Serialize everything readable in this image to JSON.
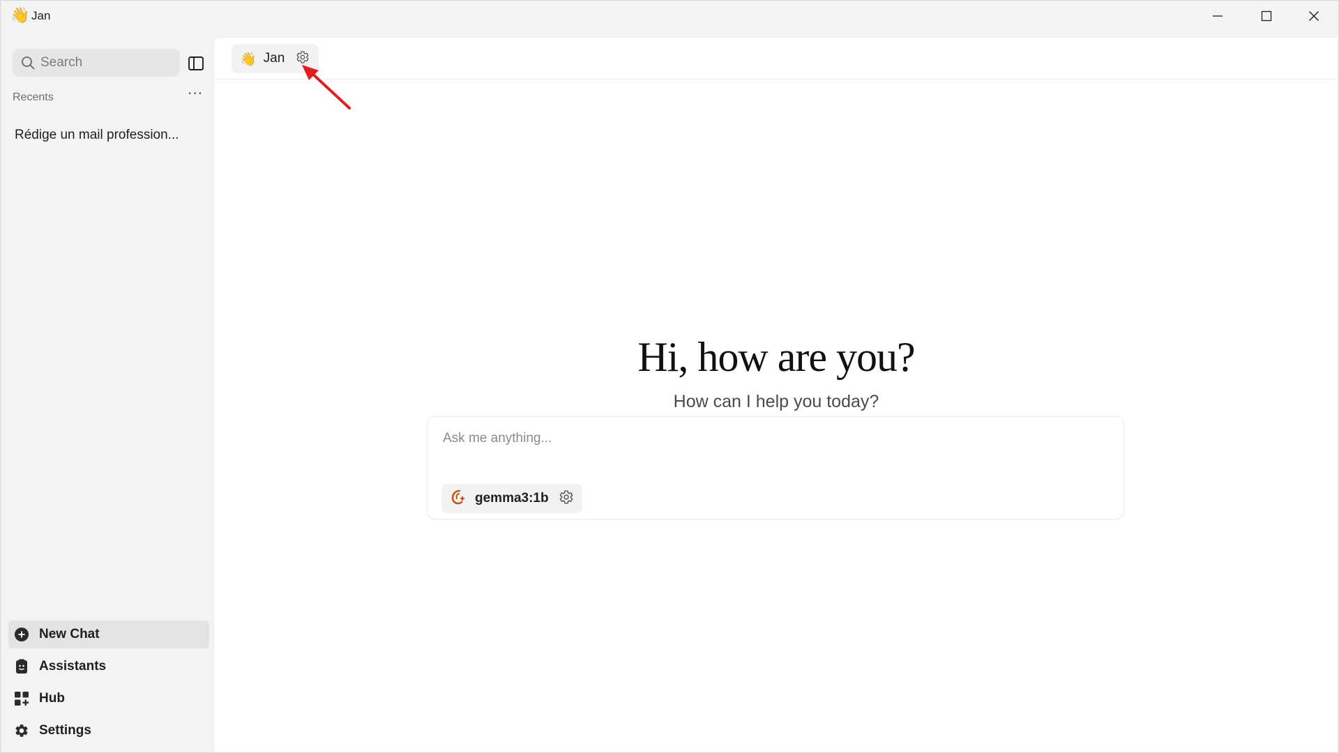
{
  "window": {
    "app_emoji": "👋",
    "title": "Jan"
  },
  "sidebar": {
    "search_placeholder": "Search",
    "recents_label": "Recents",
    "recents_more": "···",
    "recent_items": [
      {
        "label": "Rédige un mail profession..."
      }
    ],
    "nav": [
      {
        "label": "New Chat",
        "icon": "plus-circle-icon"
      },
      {
        "label": "Assistants",
        "icon": "assistant-icon"
      },
      {
        "label": "Hub",
        "icon": "grid-icon"
      },
      {
        "label": "Settings",
        "icon": "gear-icon"
      }
    ]
  },
  "header": {
    "assistant_emoji": "👋",
    "assistant_name": "Jan"
  },
  "main": {
    "greeting": "Hi, how are you?",
    "subgreeting": "How can I help you today?",
    "input_placeholder": "Ask me anything...",
    "model_name": "gemma3:1b"
  },
  "colors": {
    "annotation_arrow": "#e02020",
    "model_logo": "#c2571a"
  }
}
